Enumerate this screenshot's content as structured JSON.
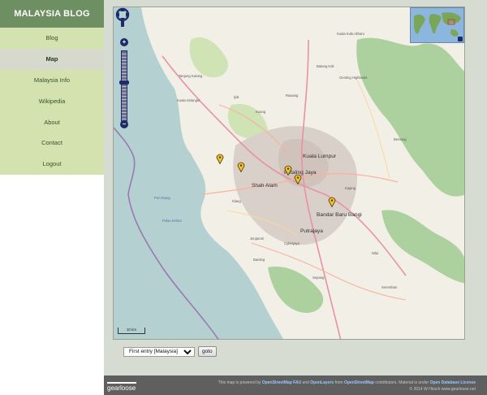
{
  "sidebar": {
    "title": "MALAYSIA BLOG",
    "items": [
      {
        "label": "Blog",
        "active": false
      },
      {
        "label": "Map",
        "active": true
      },
      {
        "label": "Malaysia Info",
        "active": false
      },
      {
        "label": "Wikipedia",
        "active": false
      },
      {
        "label": "About",
        "active": false
      },
      {
        "label": "Contact",
        "active": false
      },
      {
        "label": "Logout",
        "active": false
      }
    ]
  },
  "map": {
    "labels": {
      "kuala_kubu_bharu": "Kuala Kubu Bharu",
      "kuala_selangor": "Kuala Selangor",
      "tanjung_karang": "Tanjung Karang",
      "ijok": "Ijok",
      "kuang": "Kuang",
      "rawang": "Rawang",
      "batang_kali": "Batang Kali",
      "genting": "Genting Highlands",
      "bentong": "Bentong",
      "kuala_lumpur": "Kuala Lumpur",
      "petaling_jaya": "Petaling Jaya",
      "shah_alam": "Shah Alam",
      "klang": "Klang",
      "kajang": "Kajang",
      "bandar_baru_bangi": "Bandar Baru Bangi",
      "putrajaya": "Putrajaya",
      "jenjarom": "Jenjarom",
      "banting": "Banting",
      "sepang": "Sepang",
      "seremban": "Seremban",
      "nilai": "Nilai",
      "cyberjaya": "Cyberjaya",
      "port_klang": "Port Klang",
      "pulau_ketam": "Pulau Ketam"
    },
    "scale_label": "10 km",
    "colors": {
      "land": "#f2efe6",
      "sea": "#b5d0d0",
      "forest": "#add19e",
      "urban": "#d9d0c9",
      "marker": "#f2c230"
    }
  },
  "form": {
    "select_value": "First entry [Malaysia]",
    "goto_label": "goto"
  },
  "footer": {
    "brand": "gearloose",
    "line1_prefix": "This map is powered by",
    "link_osm_fau": "OpenStreetMap FAU",
    "and": "and",
    "link_openlayers": "OpenLayers",
    "from": "from",
    "link_osm": "OpenStreetMap",
    "line1_suffix": "contributors. Material is under",
    "link_license": "Open Database License",
    "line2": "© 2014 W Hirsch www.gearloose.net"
  }
}
